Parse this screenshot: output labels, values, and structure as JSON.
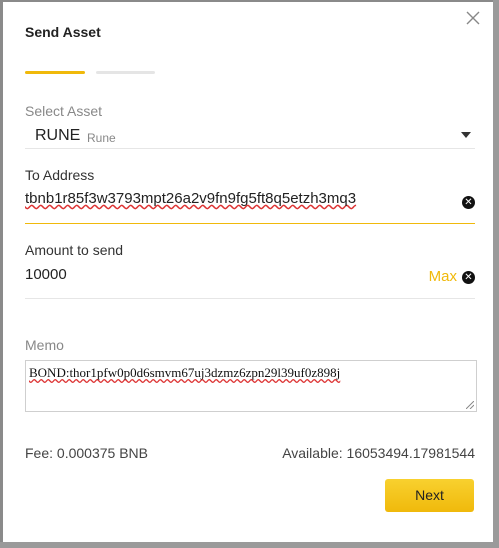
{
  "modal": {
    "title": "Send Asset",
    "steps": 2,
    "active_step": 1
  },
  "asset": {
    "label": "Select Asset",
    "symbol": "RUNE",
    "name": "Rune"
  },
  "to_address": {
    "label": "To Address",
    "value": "tbnb1r85f3w3793mpt26a2v9fn9fg5ft8q5etzh3mq3",
    "clear_icon": "close-circle-icon"
  },
  "amount": {
    "label": "Amount to send",
    "value": "10000",
    "max_label": "Max",
    "clear_icon": "close-circle-icon"
  },
  "memo": {
    "label": "Memo",
    "value": "BOND:thor1pfw0p0d6smvm67uj3dzmz6zpn29l39uf0z898j"
  },
  "footer": {
    "fee_label": "Fee:",
    "fee_value": "0.000375 BNB",
    "available_label": "Available:",
    "available_value": "16053494.17981544",
    "next_label": "Next"
  },
  "colors": {
    "accent": "#f0b90b",
    "overlay": "#8a8a8a",
    "error_underline": "#dd3333"
  }
}
